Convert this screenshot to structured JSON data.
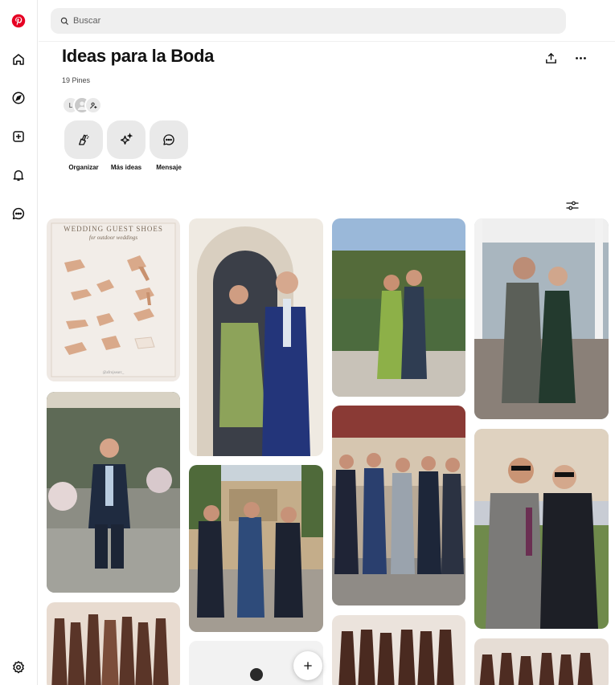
{
  "search": {
    "placeholder": "Buscar"
  },
  "board": {
    "title": "Ideas para la Boda",
    "pin_count": "19 Pines",
    "collaborator_initial": "L"
  },
  "tools": [
    {
      "label": "Organizar",
      "icon": "organize-icon"
    },
    {
      "label": "Más ideas",
      "icon": "sparkle-icon"
    },
    {
      "label": "Mensaje",
      "icon": "message-icon"
    }
  ],
  "pins": [
    {
      "title": "WEDDING GUEST SHOES",
      "subtitle": "for outdoor weddings",
      "credit": "@afrojsearc_"
    }
  ],
  "sidebar_icons": [
    "pinterest-logo-icon",
    "home-icon",
    "explore-icon",
    "create-icon",
    "notifications-icon",
    "messages-icon",
    "settings-icon"
  ],
  "colors": {
    "brand": "#e60023",
    "search_bg": "#efefef",
    "tool_bg": "#e9e9e9"
  }
}
